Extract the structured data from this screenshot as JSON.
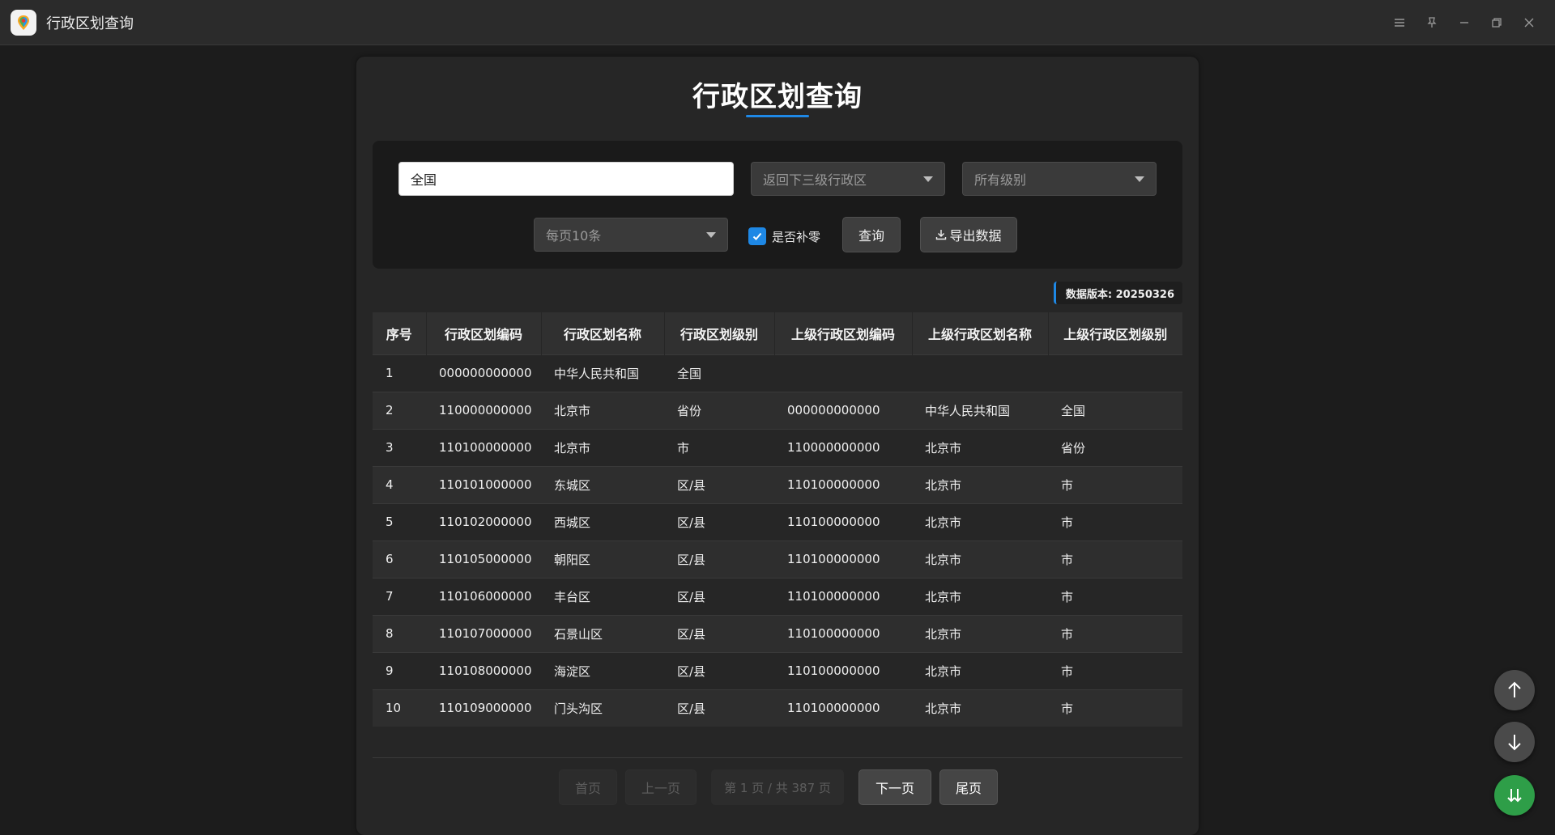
{
  "window": {
    "title": "行政区划查询"
  },
  "page": {
    "title": "行政区划查询"
  },
  "query": {
    "search_value": "全国",
    "return_select": "返回下三级行政区",
    "level_select": "所有级别",
    "page_size_select": "每页10条",
    "zero_pad_label": "是否补零",
    "zero_pad_checked": true,
    "query_button": "查询",
    "export_button": "导出数据"
  },
  "version_label": "数据版本: 20250326",
  "table": {
    "headers": [
      "序号",
      "行政区划编码",
      "行政区划名称",
      "行政区划级别",
      "上级行政区划编码",
      "上级行政区划名称",
      "上级行政区划级别"
    ],
    "rows": [
      [
        "1",
        "000000000000",
        "中华人民共和国",
        "全国",
        "",
        "",
        ""
      ],
      [
        "2",
        "110000000000",
        "北京市",
        "省份",
        "000000000000",
        "中华人民共和国",
        "全国"
      ],
      [
        "3",
        "110100000000",
        "北京市",
        "市",
        "110000000000",
        "北京市",
        "省份"
      ],
      [
        "4",
        "110101000000",
        "东城区",
        "区/县",
        "110100000000",
        "北京市",
        "市"
      ],
      [
        "5",
        "110102000000",
        "西城区",
        "区/县",
        "110100000000",
        "北京市",
        "市"
      ],
      [
        "6",
        "110105000000",
        "朝阳区",
        "区/县",
        "110100000000",
        "北京市",
        "市"
      ],
      [
        "7",
        "110106000000",
        "丰台区",
        "区/县",
        "110100000000",
        "北京市",
        "市"
      ],
      [
        "8",
        "110107000000",
        "石景山区",
        "区/县",
        "110100000000",
        "北京市",
        "市"
      ],
      [
        "9",
        "110108000000",
        "海淀区",
        "区/县",
        "110100000000",
        "北京市",
        "市"
      ],
      [
        "10",
        "110109000000",
        "门头沟区",
        "区/县",
        "110100000000",
        "北京市",
        "市"
      ]
    ]
  },
  "pagination": {
    "first": "首页",
    "prev": "上一页",
    "info": "第 1 页 / 共 387 页",
    "next": "下一页",
    "last": "尾页"
  },
  "icons": {
    "app": "map-pin-icon",
    "menu": "menu-icon",
    "pin": "pin-icon",
    "minimize": "minimize-icon",
    "restore": "restore-icon",
    "close": "close-icon",
    "export": "download-icon",
    "scroll_top": "arrow-up-icon",
    "scroll_down": "arrow-down-icon",
    "scroll_bottom": "double-arrow-down-icon"
  },
  "colors": {
    "accent": "#1e88e5",
    "fab_green": "#2e9e48"
  }
}
